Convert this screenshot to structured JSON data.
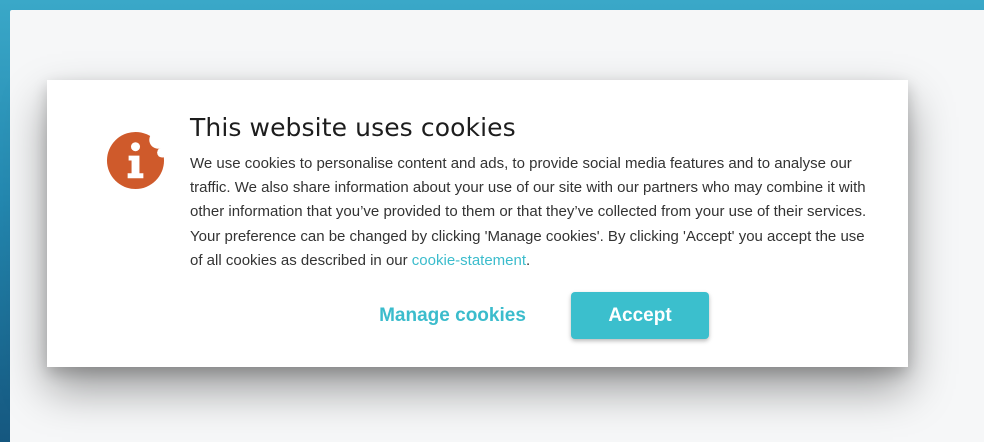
{
  "banner": {
    "title": "This website uses cookies",
    "body_text": "We use cookies to personalise content and ads, to provide social media features and to analyse our traffic. We also share information about your use of our site with our partners who may combine it with other information that you’ve provided to them or that they’ve collected from your use of their services. Your preference can be changed by clicking 'Manage cookies'. By clicking 'Accept' you accept the use of all cookies as described in our",
    "link_text": "cookie-statement",
    "after_link": ".",
    "icon": "info-cookie-icon",
    "buttons": {
      "manage_label": "Manage cookies",
      "accept_label": "Accept"
    }
  },
  "colors": {
    "accent": "#3bbfcd",
    "icon": "#cf5a2b",
    "page_bg_top": "#3aa8c8",
    "page_bg_bottom": "#15577f"
  }
}
